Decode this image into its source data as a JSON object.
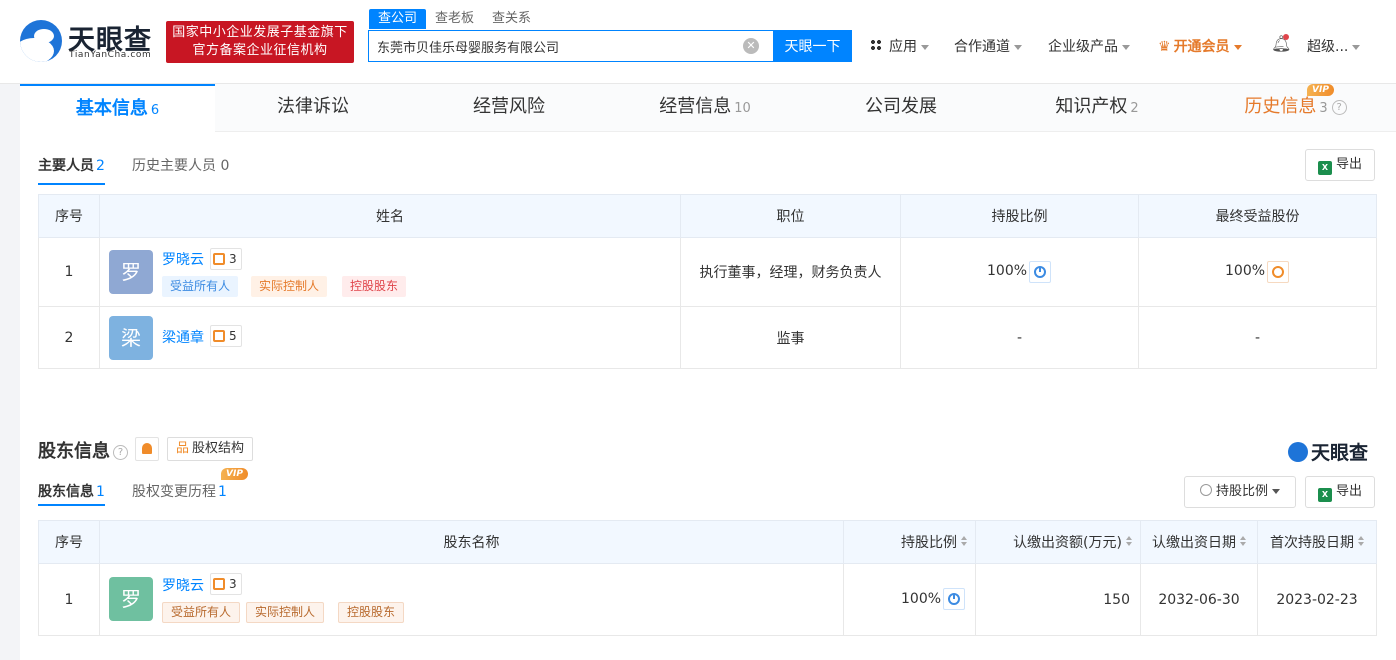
{
  "header": {
    "logo_title": "天眼查",
    "logo_sub": "TianYanCha.com",
    "gov_badge_line1": "国家中小企业发展子基金旗下",
    "gov_badge_line2": "官方备案企业征信机构",
    "search_tabs": [
      "查公司",
      "查老板",
      "查关系"
    ],
    "search_value": "东莞市贝佳乐母婴服务有限公司",
    "search_button": "天眼一下",
    "nav": {
      "apps": "应用",
      "coop": "合作通道",
      "enterprise": "企业级产品",
      "vip": "开通会员",
      "user": "超级..."
    }
  },
  "tabs": [
    {
      "label": "基本信息",
      "count": "6"
    },
    {
      "label": "法律诉讼",
      "count": ""
    },
    {
      "label": "经营风险",
      "count": ""
    },
    {
      "label": "经营信息",
      "count": "10"
    },
    {
      "label": "公司发展",
      "count": ""
    },
    {
      "label": "知识产权",
      "count": "2"
    },
    {
      "label": "历史信息",
      "count": "3",
      "vip": "VIP"
    }
  ],
  "personnel": {
    "subtab_main": "主要人员",
    "subtab_main_count": "2",
    "subtab_hist": "历史主要人员 0",
    "export": "导出",
    "columns": [
      "序号",
      "姓名",
      "职位",
      "持股比例",
      "最终受益股份"
    ],
    "rows": [
      {
        "idx": "1",
        "avatar": "罗",
        "name": "罗晓云",
        "rel": "3",
        "tags": [
          "受益所有人",
          "实际控制人",
          "控股股东"
        ],
        "position": "执行董事，经理，财务负责人",
        "ratio": "100%",
        "benefit": "100%"
      },
      {
        "idx": "2",
        "avatar": "梁",
        "name": "梁通章",
        "rel": "5",
        "tags": [],
        "position": "监事",
        "ratio": "-",
        "benefit": "-"
      }
    ]
  },
  "shareholders": {
    "title": "股东信息",
    "structure_button": "股权结构",
    "brand": "天眼查",
    "subtab_main": "股东信息",
    "subtab_main_count": "1",
    "subtab_hist": "股权变更历程",
    "subtab_hist_count": "1",
    "subtab_vip": "VIP",
    "ratio_button": "持股比例",
    "export": "导出",
    "columns": [
      "序号",
      "股东名称",
      "持股比例",
      "认缴出资额(万元)",
      "认缴出资日期",
      "首次持股日期"
    ],
    "rows": [
      {
        "idx": "1",
        "avatar": "罗",
        "name": "罗晓云",
        "rel": "3",
        "tags": [
          "受益所有人",
          "实际控制人",
          "控股股东"
        ],
        "ratio": "100%",
        "amount": "150",
        "date": "2032-06-30",
        "first": "2023-02-23"
      }
    ]
  },
  "colors": {
    "accent": "#0084ff",
    "brand_red": "#c81623",
    "avatar_person1": "#8fa8d3",
    "avatar_person2": "#7eb2e0",
    "avatar_holder": "#6fc0a0"
  }
}
